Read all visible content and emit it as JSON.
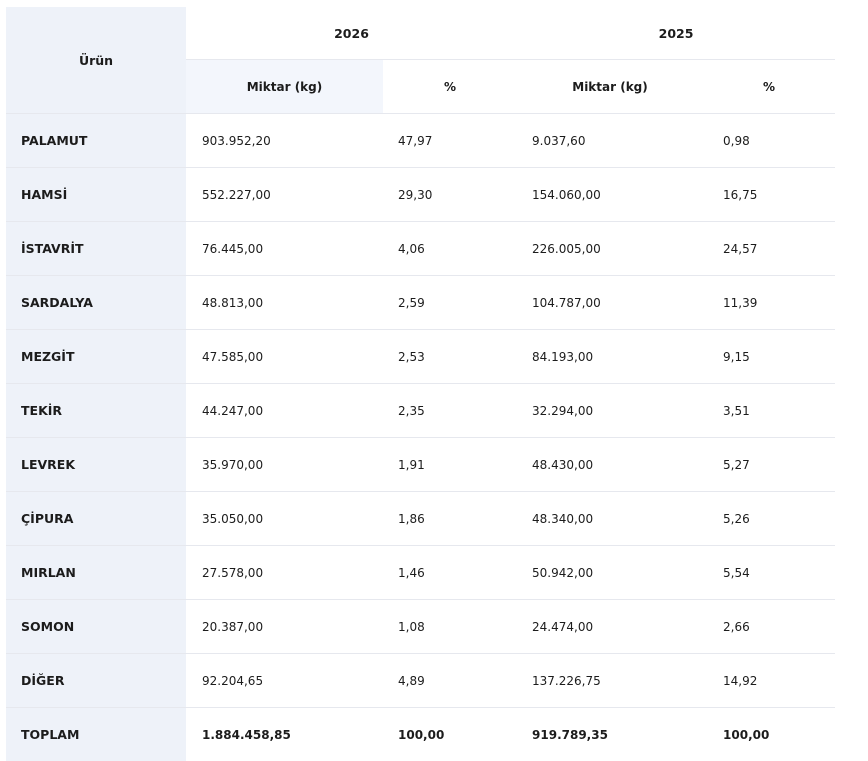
{
  "header": {
    "product_label": "Ürün",
    "years": [
      "2026",
      "2025"
    ],
    "sub_columns": [
      "Miktar (kg)",
      "%",
      "Miktar (kg)",
      "%"
    ]
  },
  "rows": [
    {
      "name": "PALAMUT",
      "kg_2026": "903.952,20",
      "pct_2026": "47,97",
      "kg_2025": "9.037,60",
      "pct_2025": "0,98"
    },
    {
      "name": "HAMSİ",
      "kg_2026": "552.227,00",
      "pct_2026": "29,30",
      "kg_2025": "154.060,00",
      "pct_2025": "16,75"
    },
    {
      "name": "İSTAVRİT",
      "kg_2026": "76.445,00",
      "pct_2026": "4,06",
      "kg_2025": "226.005,00",
      "pct_2025": "24,57"
    },
    {
      "name": "SARDALYA",
      "kg_2026": "48.813,00",
      "pct_2026": "2,59",
      "kg_2025": "104.787,00",
      "pct_2025": "11,39"
    },
    {
      "name": "MEZGİT",
      "kg_2026": "47.585,00",
      "pct_2026": "2,53",
      "kg_2025": "84.193,00",
      "pct_2025": "9,15"
    },
    {
      "name": "TEKİR",
      "kg_2026": "44.247,00",
      "pct_2026": "2,35",
      "kg_2025": "32.294,00",
      "pct_2025": "3,51"
    },
    {
      "name": "LEVREK",
      "kg_2026": "35.970,00",
      "pct_2026": "1,91",
      "kg_2025": "48.430,00",
      "pct_2025": "5,27"
    },
    {
      "name": "ÇİPURA",
      "kg_2026": "35.050,00",
      "pct_2026": "1,86",
      "kg_2025": "48.340,00",
      "pct_2025": "5,26"
    },
    {
      "name": "MIRLAN",
      "kg_2026": "27.578,00",
      "pct_2026": "1,46",
      "kg_2025": "50.942,00",
      "pct_2025": "5,54"
    },
    {
      "name": "SOMON",
      "kg_2026": "20.387,00",
      "pct_2026": "1,08",
      "kg_2025": "24.474,00",
      "pct_2025": "2,66"
    },
    {
      "name": "DİĞER",
      "kg_2026": "92.204,65",
      "pct_2026": "4,89",
      "kg_2025": "137.226,75",
      "pct_2025": "14,92"
    },
    {
      "name": "TOPLAM",
      "kg_2026": "1.884.458,85",
      "pct_2026": "100,00",
      "kg_2025": "919.789,35",
      "pct_2025": "100,00"
    }
  ]
}
